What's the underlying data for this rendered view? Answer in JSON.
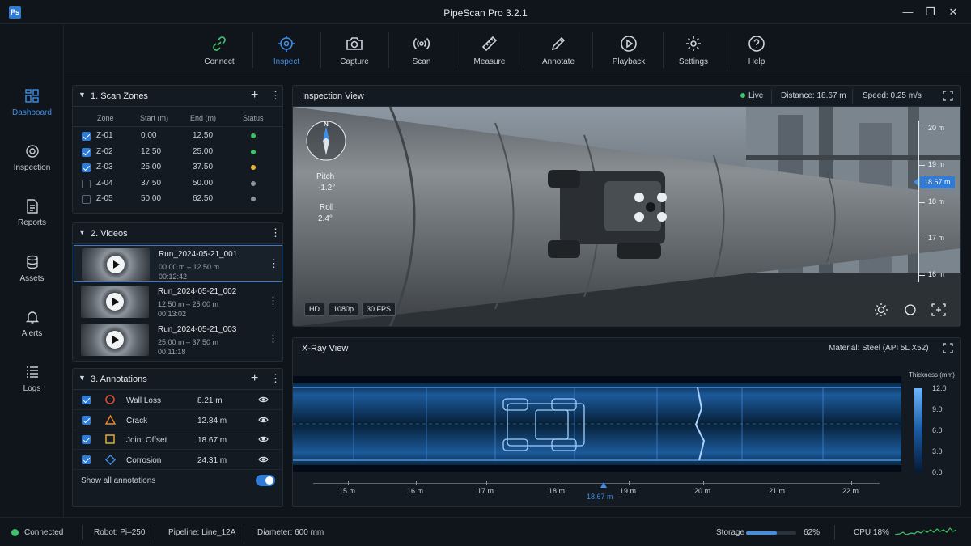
{
  "app": {
    "logo": "Ps",
    "title": "PipeScan Pro 3.2.1",
    "window_controls": {
      "minimize": "—",
      "maximize": "❐",
      "close": "✕"
    }
  },
  "sidebar": {
    "items": [
      {
        "label": "Dashboard",
        "icon": "dashboard-icon",
        "active": true
      },
      {
        "label": "Inspection",
        "icon": "inspection-icon"
      },
      {
        "label": "Reports",
        "icon": "reports-icon"
      },
      {
        "label": "Assets",
        "icon": "assets-icon"
      },
      {
        "label": "Alerts",
        "icon": "bell-icon"
      },
      {
        "label": "Logs",
        "icon": "logs-icon"
      }
    ]
  },
  "toolbar": {
    "items": [
      {
        "label": "Connect",
        "icon": "link-icon",
        "color": "#3fc26a"
      },
      {
        "label": "Inspect",
        "icon": "target-icon",
        "active": true
      },
      {
        "label": "Capture",
        "icon": "camera-icon"
      },
      {
        "label": "Scan",
        "icon": "scan-icon"
      },
      {
        "label": "Measure",
        "icon": "ruler-icon"
      },
      {
        "label": "Annotate",
        "icon": "pencil-icon"
      },
      {
        "label": "Playback",
        "icon": "play-icon"
      },
      {
        "label": "Settings",
        "icon": "gear-icon"
      },
      {
        "label": "Help",
        "icon": "help-icon"
      }
    ]
  },
  "scan_zones": {
    "title": "1. Scan Zones",
    "headers": [
      "Zone",
      "Start (m)",
      "End (m)",
      "Status"
    ],
    "rows": [
      {
        "zone": "Z-01",
        "start": "0.00",
        "end": "12.50",
        "checked": true,
        "status_color": "#3fc26a"
      },
      {
        "zone": "Z-02",
        "start": "12.50",
        "end": "25.00",
        "checked": true,
        "status_color": "#3fc26a"
      },
      {
        "zone": "Z-03",
        "start": "25.00",
        "end": "37.50",
        "checked": true,
        "status_color": "#e6b93a"
      },
      {
        "zone": "Z-04",
        "start": "37.50",
        "end": "50.00",
        "checked": false,
        "status_color": "#8a939e"
      },
      {
        "zone": "Z-05",
        "start": "50.00",
        "end": "62.50",
        "checked": false,
        "status_color": "#8a939e"
      }
    ]
  },
  "videos": {
    "title": "2. Videos",
    "items": [
      {
        "name": "Run_2024-05-21_001",
        "range": "00.00 m – 12.50 m",
        "duration": "00:12:42",
        "selected": true
      },
      {
        "name": "Run_2024-05-21_002",
        "range": "12.50 m – 25.00 m",
        "duration": "00:13:02"
      },
      {
        "name": "Run_2024-05-21_003",
        "range": "25.00 m – 37.50 m",
        "duration": "00:11:18"
      }
    ]
  },
  "annotations": {
    "title": "3. Annotations",
    "items": [
      {
        "name": "Wall Loss",
        "value": "8.21 m",
        "shape": "circle-icon",
        "color": "#e8553a"
      },
      {
        "name": "Crack",
        "value": "12.84 m",
        "shape": "triangle-icon",
        "color": "#f08a2a"
      },
      {
        "name": "Joint Offset",
        "value": "18.67 m",
        "shape": "square-icon",
        "color": "#e6b93a"
      },
      {
        "name": "Corrosion",
        "value": "24.31 m",
        "shape": "diamond-icon",
        "color": "#3f8fe8"
      }
    ],
    "show_all_label": "Show all annotations",
    "show_all": true
  },
  "inspection": {
    "title": "Inspection View",
    "live": "Live",
    "distance": "Distance: 18.67 m",
    "speed": "Speed: 0.25 m/s",
    "compass_n": "N",
    "pitch_label": "Pitch",
    "pitch": "-1.2°",
    "roll_label": "Roll",
    "roll": "2.4°",
    "chips": [
      "HD",
      "1080p",
      "30 FPS"
    ],
    "scale": {
      "labels": [
        "20 m",
        "19 m",
        "18 m",
        "17 m",
        "16 m"
      ],
      "current": "18.67 m"
    }
  },
  "xray": {
    "title": "X-Ray View",
    "material": "Material: Steel (API 5L X52)",
    "legend_title": "Thickness (mm)",
    "legend_values": [
      "12.0",
      "9.0",
      "6.0",
      "3.0",
      "0.0"
    ],
    "axis": [
      "15 m",
      "16 m",
      "17 m",
      "18 m",
      "19 m",
      "20 m",
      "21 m",
      "22 m"
    ],
    "marker": "18.67 m"
  },
  "status": {
    "connected": "Connected",
    "robot": "Robot: Pi–250",
    "pipeline": "Pipeline: Line_12A",
    "diameter": "Diameter: 600 mm",
    "storage_label": "Storage",
    "storage_pct": "62%",
    "storage_fraction": 0.62,
    "cpu": "CPU 18%"
  }
}
